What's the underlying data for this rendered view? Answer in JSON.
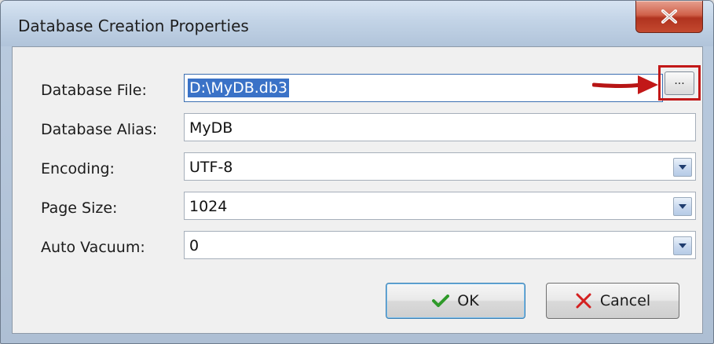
{
  "window": {
    "title": "Database Creation Properties"
  },
  "form": {
    "database_file": {
      "label": "Database File:",
      "value": "D:\\MyDB.db3"
    },
    "browse_label": "...",
    "database_alias": {
      "label": "Database Alias:",
      "value": "MyDB"
    },
    "encoding": {
      "label": "Encoding:",
      "value": "UTF-8"
    },
    "page_size": {
      "label": "Page Size:",
      "value": "1024"
    },
    "auto_vacuum": {
      "label": "Auto Vacuum:",
      "value": "0"
    }
  },
  "buttons": {
    "ok": "OK",
    "cancel": "Cancel"
  },
  "colors": {
    "annotation": "#c21818",
    "selection": "#3a72c7",
    "ok_check": "#2f9a2a",
    "cancel_x": "#d42020"
  },
  "icons": {
    "close": "close-icon",
    "ok": "checkmark-icon",
    "cancel": "x-icon",
    "combo": "chevron-down-icon",
    "annotation": "red-arrow-icon"
  }
}
